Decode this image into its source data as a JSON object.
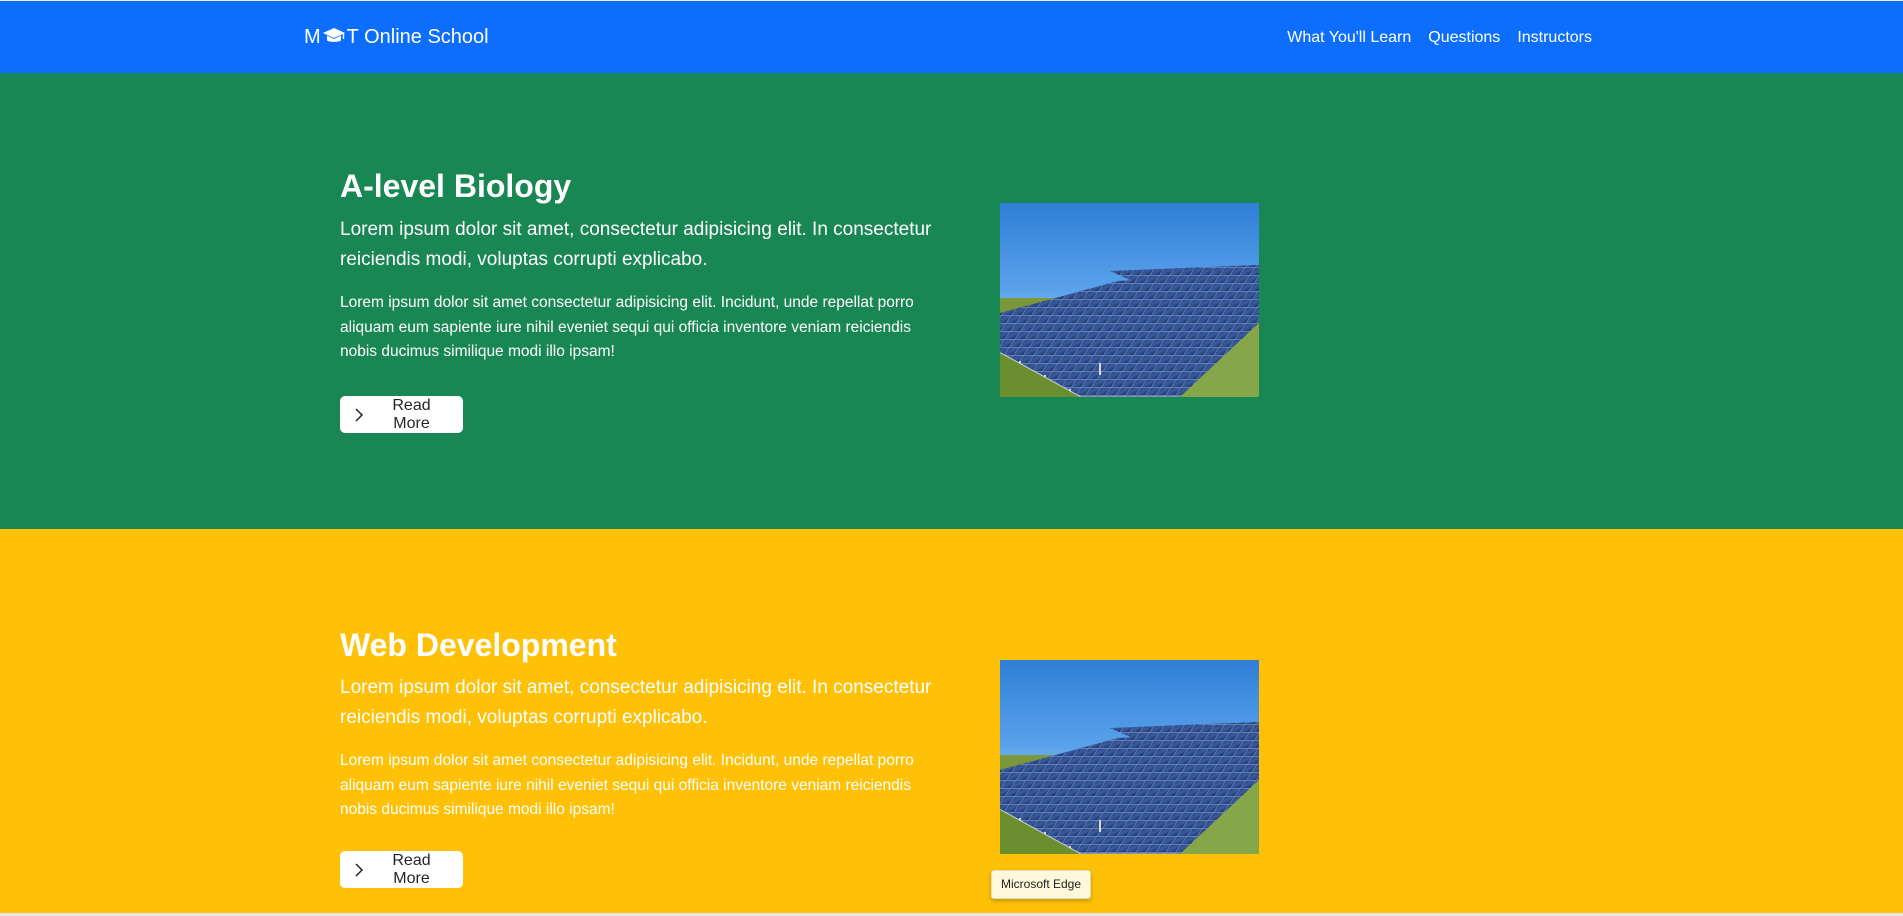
{
  "navbar": {
    "brand": "MCT Online School",
    "brand_prefix": "M",
    "brand_suffix": "T Online School",
    "brand_icon": "graduation-cap-icon",
    "color": "#0d6efd",
    "links": [
      {
        "label": "What You'll Learn"
      },
      {
        "label": "Questions"
      },
      {
        "label": "Instructors"
      }
    ]
  },
  "sections": [
    {
      "color": "#198754",
      "title": "A-level Biology",
      "lead": "Lorem ipsum dolor sit amet, consectetur adipisicing elit. In consectetur reiciendis modi, voluptas corrupti explicabo.",
      "body": "Lorem ipsum dolor sit amet consectetur adipisicing elit. Incidunt, unde repellat porro aliquam eum sapiente iure nihil eveniet sequi qui officia inventore veniam reiciendis nobis ducimus similique modi illo ipsam!",
      "button": "Read More",
      "button_icon": "chevron-right-icon",
      "image": "solar-panels-image"
    },
    {
      "color": "#ffc107",
      "title": "Web Development",
      "lead": "Lorem ipsum dolor sit amet, consectetur adipisicing elit. In consectetur reiciendis modi, voluptas corrupti explicabo.",
      "body": "Lorem ipsum dolor sit amet consectetur adipisicing elit. Incidunt, unde repellat porro aliquam eum sapiente iure nihil eveniet sequi qui officia inventore veniam reiciendis nobis ducimus similique modi illo ipsam!",
      "button": "Read More",
      "button_icon": "chevron-right-icon",
      "image": "solar-panels-image"
    }
  ],
  "tooltip": {
    "text": "Microsoft Edge"
  }
}
